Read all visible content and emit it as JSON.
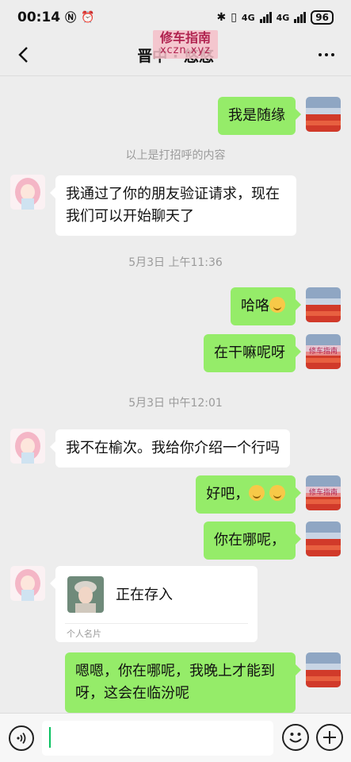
{
  "status_bar": {
    "time": "00:14",
    "signal_1": "4G",
    "signal_2": "4G",
    "battery": "96"
  },
  "header": {
    "title": "晋中 · 悠悠",
    "watermark_top": "修车指南",
    "watermark_bottom": "xczn.xyz"
  },
  "messages": {
    "m1": "我是随缘",
    "system_greeting": "以上是打招呼的内容",
    "m2": "我通过了你的朋友验证请求，现在我们可以开始聊天了",
    "time1": "5月3日 上午11:36",
    "m3": "哈咯",
    "m4": "在干嘛呢呀",
    "time2": "5月3日 中午12:01",
    "m5": "我不在榆次。我给你介绍一个行吗",
    "m6": "好吧，",
    "m7": "你在哪呢，",
    "card_name": "正在存入",
    "card_label": "个人名片",
    "m8": "嗯嗯，你在哪呢，我晚上才能到呀，这会在临汾呢"
  },
  "avatar_watermark": "修车指南",
  "colors": {
    "sent_bubble": "#95ec69",
    "received_bubble": "#ffffff",
    "background": "#ededed",
    "accent": "#07c160"
  }
}
